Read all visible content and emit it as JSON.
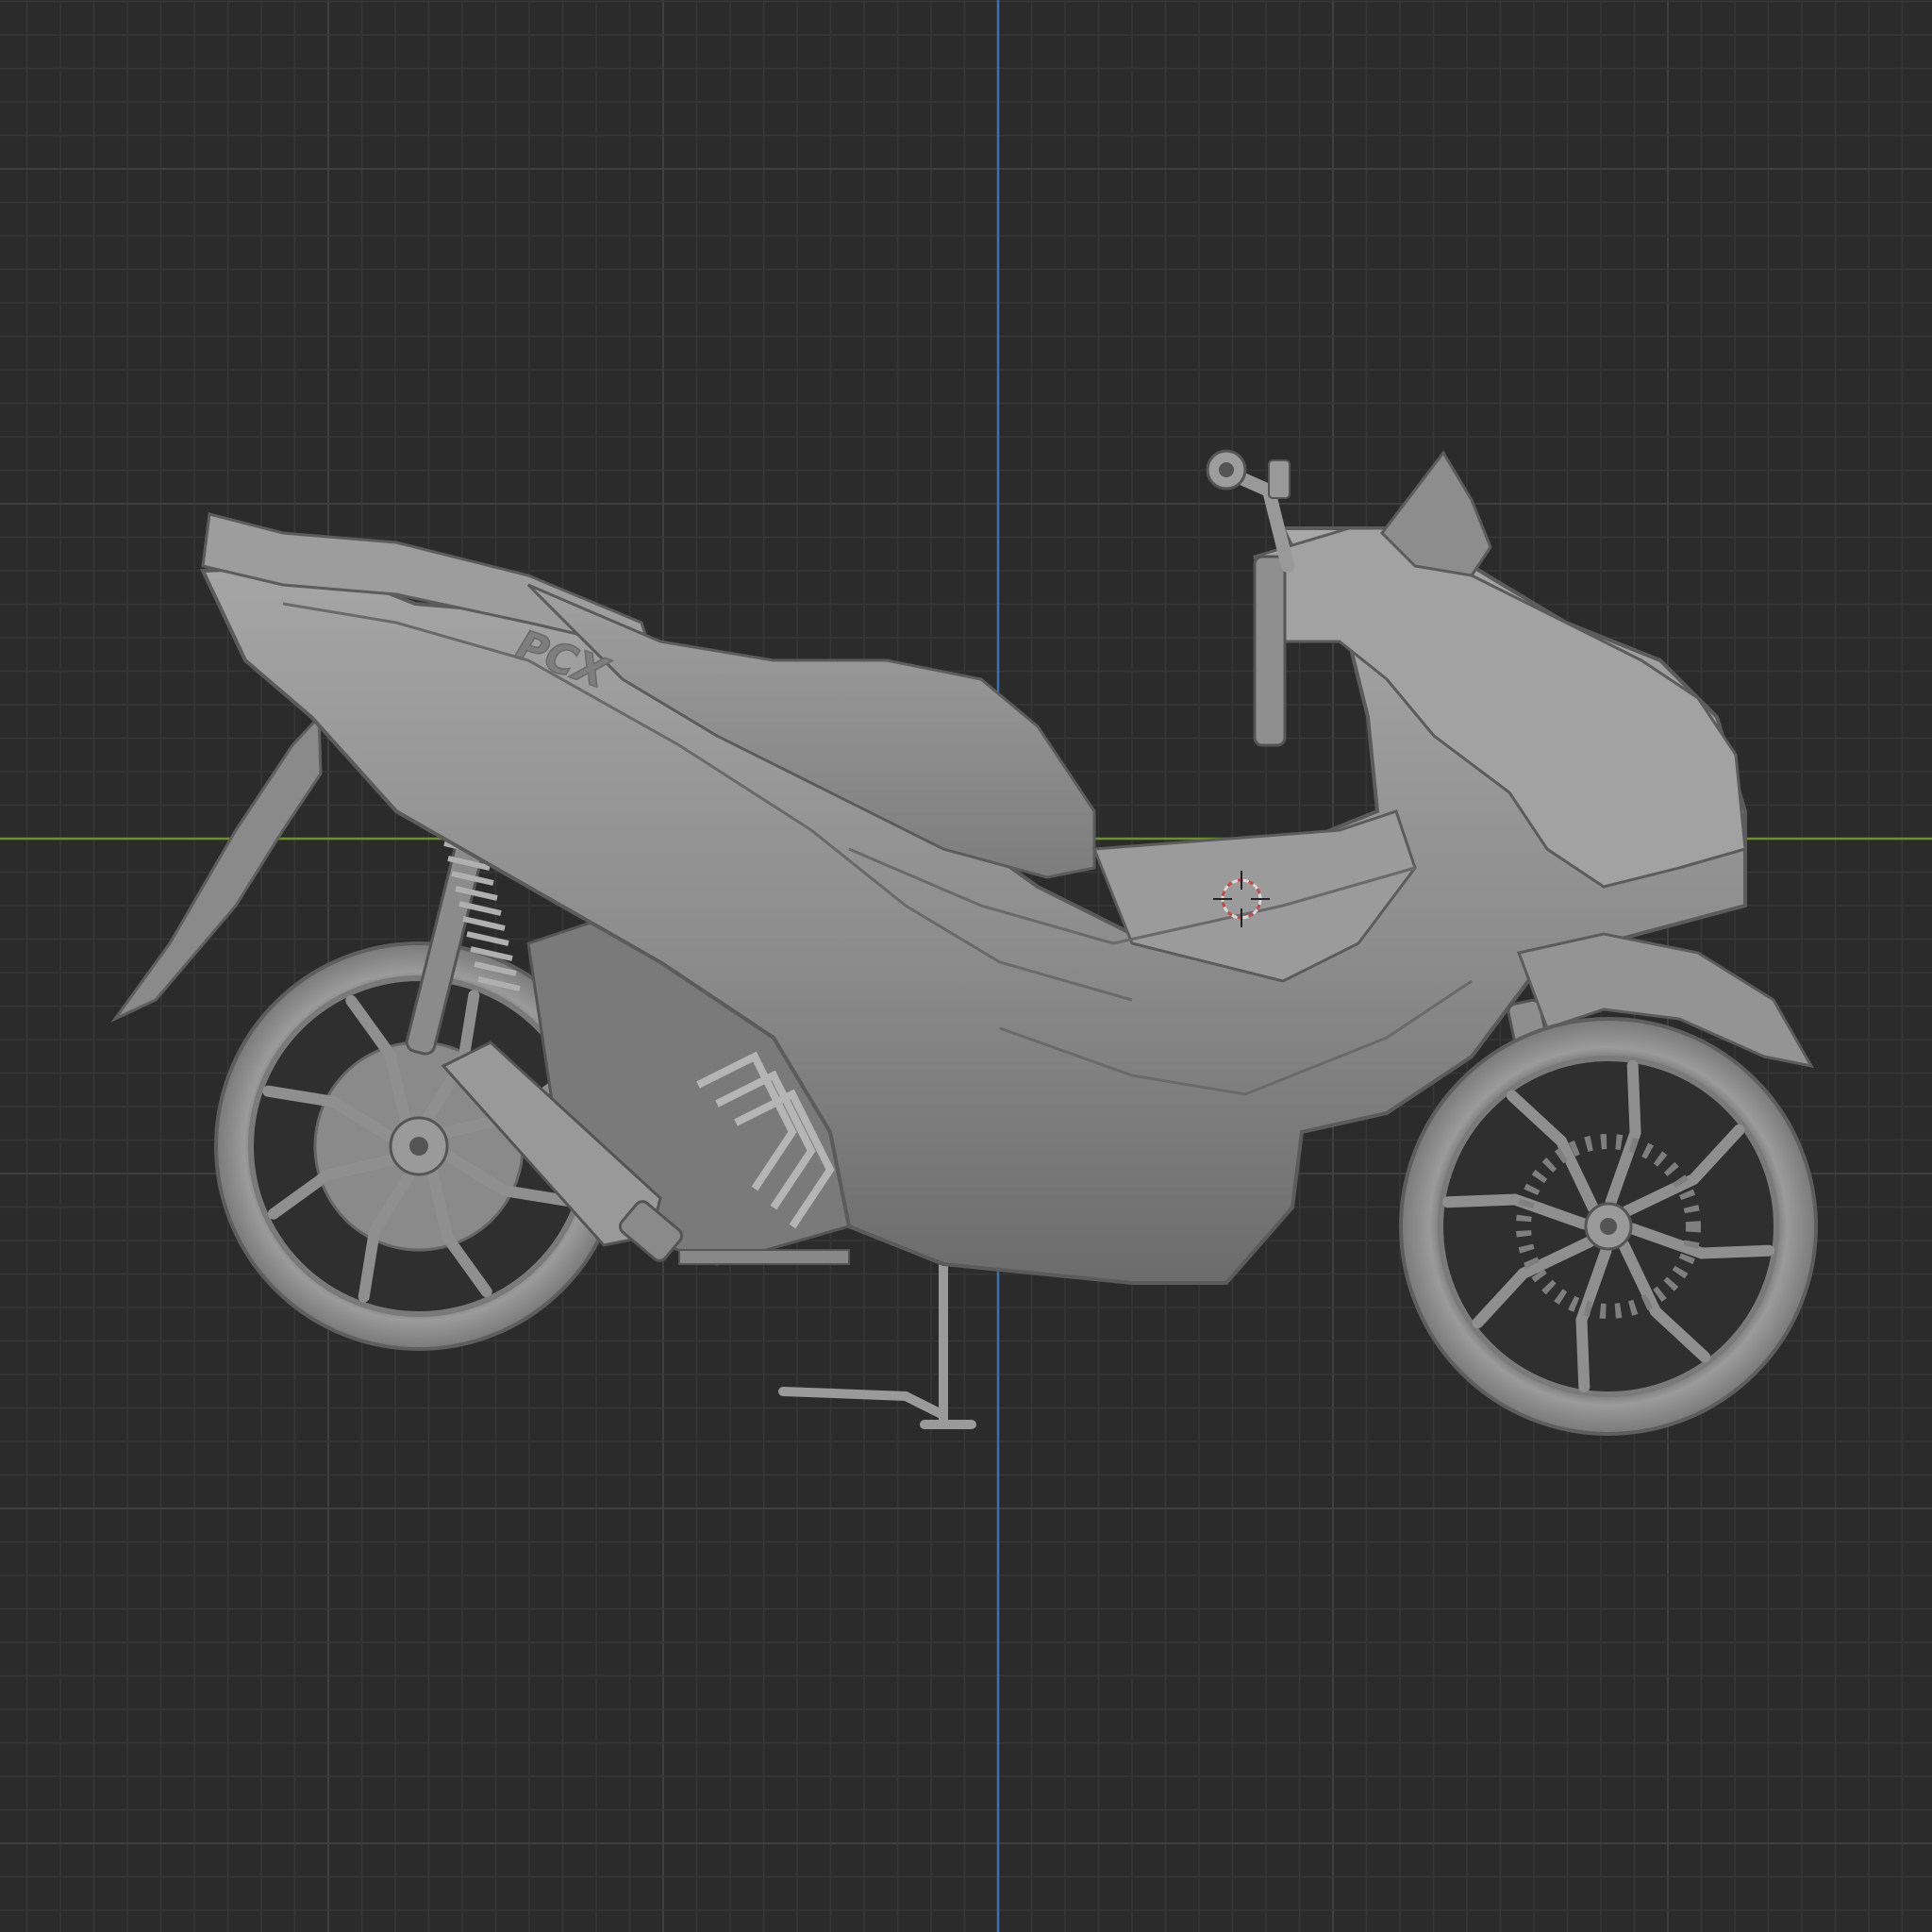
{
  "viewport": {
    "background_color": "#2b2b2b",
    "grid_minor_color": "#363636",
    "grid_major_color": "#3f3f3f",
    "x_axis_color": "#6f8f2f",
    "y_axis_color": "#3b6fb0",
    "view_mode": "solid",
    "cursor_icon": "3d-cursor-icon"
  },
  "model": {
    "name": "scooter",
    "badge_text": "PCX",
    "body_color": "#8e8e8e",
    "body_light_color": "#a9a9a9",
    "body_dark_color": "#6b6b6b",
    "detail_color": "#5a5a5a"
  }
}
